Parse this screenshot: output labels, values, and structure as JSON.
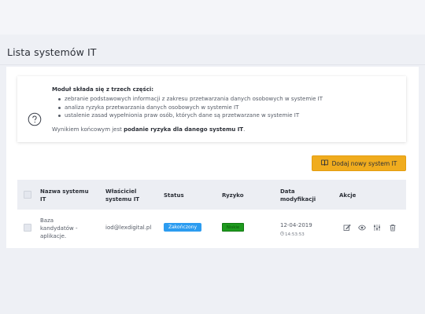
{
  "page": {
    "title": "Lista systemów IT"
  },
  "info": {
    "heading": "Moduł składa się z trzech części:",
    "bullets": [
      "zebranie podstawowych informacji z zakresu przetwarzania danych osobowych w systemie IT",
      "analiza ryzyka przetwarzania danych osobowych w systemie IT",
      "ustalenie zasad wypełnionia praw osób, których dane są przetwarzane w systemie IT"
    ],
    "conclusion_prefix": "Wynikiem końcowym jest ",
    "conclusion_bold": "podanie ryzyka dla danego systemu IT",
    "conclusion_suffix": ".",
    "help_icon": "question-circle-icon"
  },
  "toolbar": {
    "add_label": "Dodaj nowy system IT",
    "add_icon": "book-icon",
    "accent_color": "#f0ac1e"
  },
  "table": {
    "headers": {
      "name_line1": "Nazwa systemu",
      "name_line2": "IT",
      "owner_line1": "Właściciel",
      "owner_line2": "systemu IT",
      "status": "Status",
      "risk": "Ryzyko",
      "date_line1": "Data",
      "date_line2": "modyfikacji",
      "actions": "Akcje"
    },
    "rows": [
      {
        "name_line1": "Baza",
        "name_line2": "kandydatów -",
        "name_line3": "aplikacje.",
        "owner": "iod@lexdigital.pl",
        "status": "Zakończony",
        "status_color": "#2c9cf0",
        "risk": "Niskie",
        "risk_color": "#1e9a1e",
        "date": "12-04-2019",
        "time": "14:53:53",
        "actions": [
          "edit-icon",
          "eye-icon",
          "settings-icon",
          "trash-icon"
        ]
      }
    ]
  }
}
